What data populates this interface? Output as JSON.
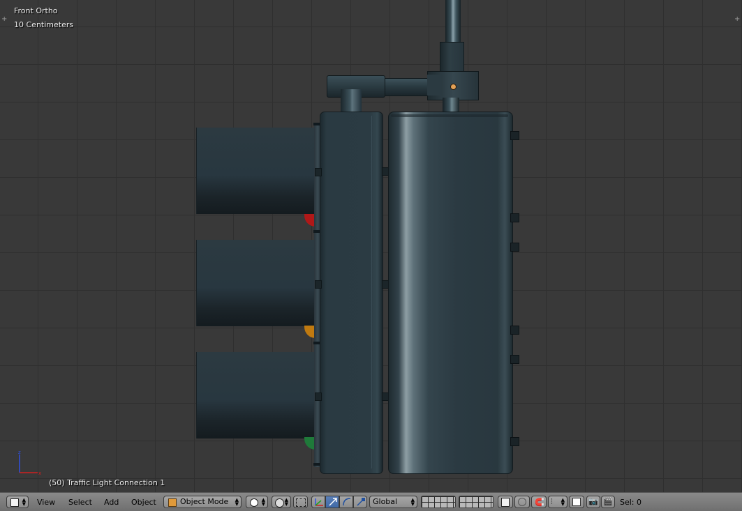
{
  "viewport": {
    "view_name": "Front Ortho",
    "grid_scale": "10 Centimeters",
    "object_info": "(50) Traffic Light Connection 1",
    "axes": {
      "x": "x",
      "z": "z"
    }
  },
  "header": {
    "editor_type_icon": "cube-icon",
    "menus": {
      "view": "View",
      "select": "Select",
      "add": "Add",
      "object": "Object"
    },
    "mode": "Object Mode",
    "pivot_icon": "circle-icon",
    "orientation": "Global",
    "selection_status": "Sel: 0"
  },
  "colors": {
    "red_light": "#b01818",
    "yellow_light": "#c07a10",
    "green_light": "#1f7a3a",
    "origin": "#e3a157",
    "axis_x": "#d02020",
    "axis_z": "#3050e0"
  }
}
